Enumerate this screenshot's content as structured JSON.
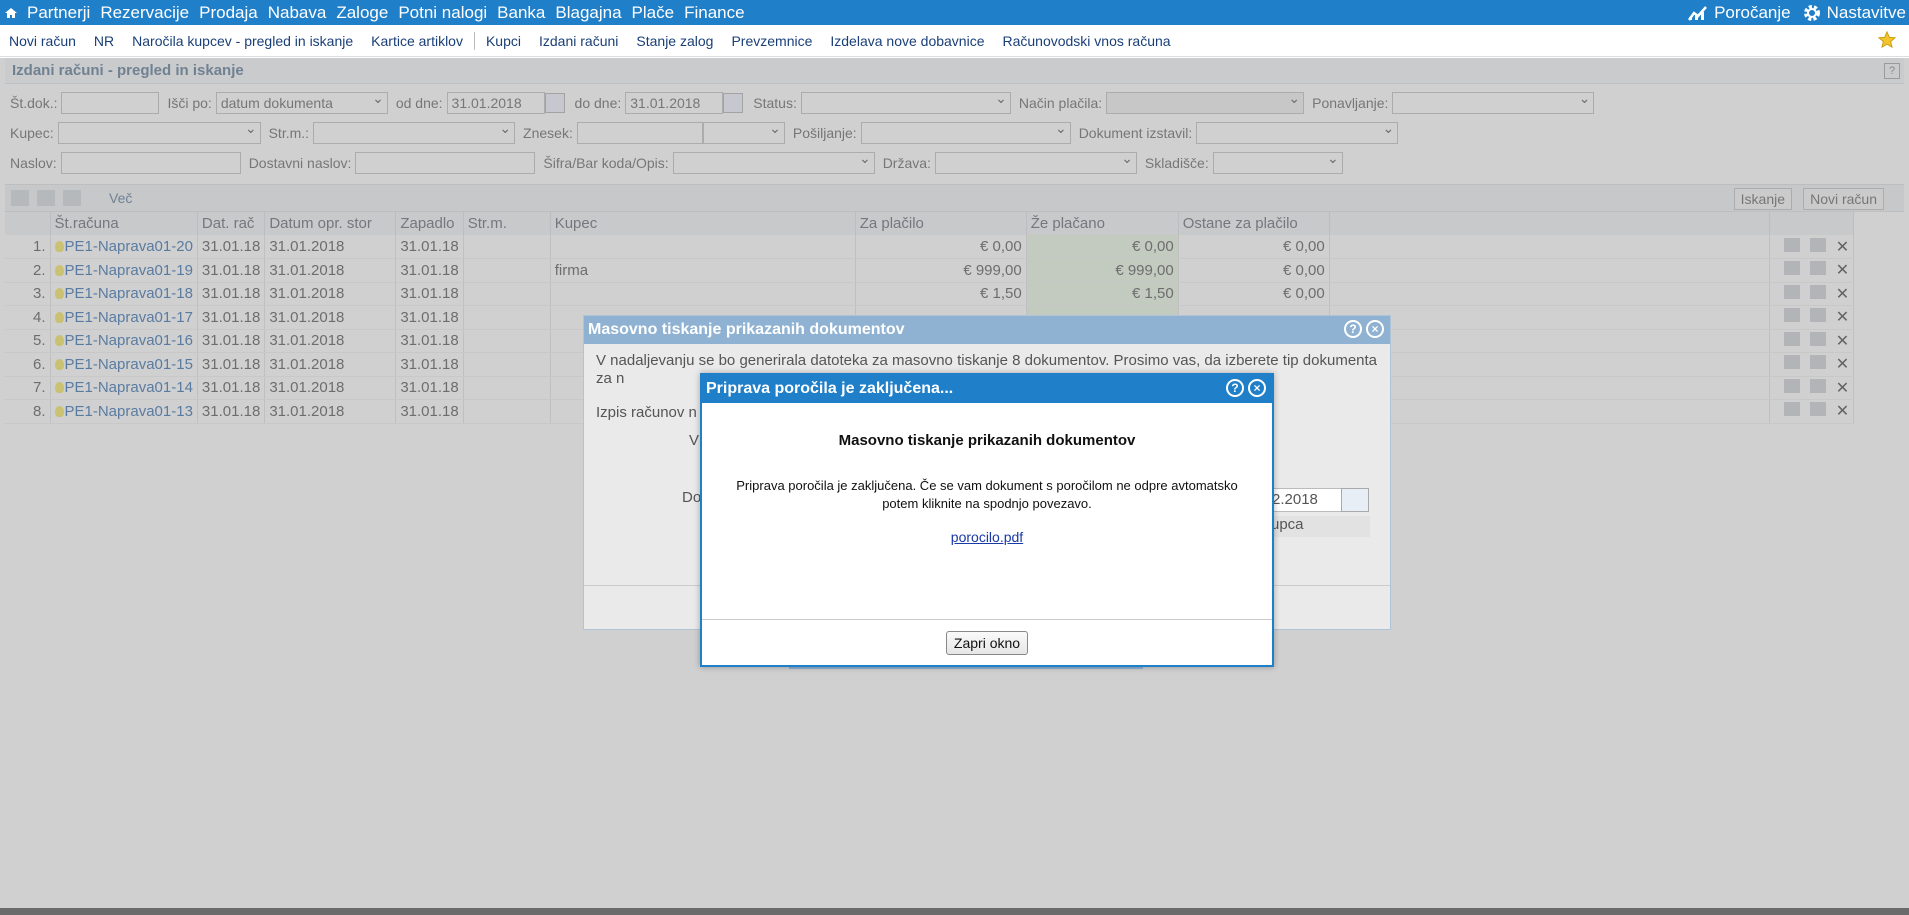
{
  "topnav": {
    "items": [
      "Partnerji",
      "Rezervacije",
      "Prodaja",
      "Nabava",
      "Zaloge",
      "Potni nalogi",
      "Banka",
      "Blagajna",
      "Plače",
      "Finance"
    ],
    "reporting": "Poročanje",
    "settings": "Nastavitve"
  },
  "subnav": {
    "items": [
      "Novi račun",
      "NR",
      "Naročila kupcev - pregled in iskanje",
      "Kartice artiklov",
      "Kupci",
      "Izdani računi",
      "Stanje zalog",
      "Prevzemnice",
      "Izdelava nove dobavnice",
      "Računovodski vnos računa"
    ]
  },
  "page": {
    "title": "Izdani računi - pregled in iskanje",
    "help": "?"
  },
  "filters": {
    "st_dok": "Št.dok.:",
    "isci_po": "Išči po:",
    "isci_po_value": "datum dokumenta",
    "od_dne": "od dne:",
    "od_dne_value": "31.01.2018",
    "do_dne": "do dne:",
    "do_dne_value": "31.01.2018",
    "status": "Status:",
    "nacin_placila": "Način plačila:",
    "ponavljanje": "Ponavljanje:",
    "kupec": "Kupec:",
    "str_m": "Str.m.:",
    "znesek": "Znesek:",
    "posiljanje": "Pošiljanje:",
    "dokument_izstavil": "Dokument izstavil:",
    "naslov": "Naslov:",
    "dostavni_naslov": "Dostavni naslov:",
    "sifra": "Šifra/Bar koda/Opis:",
    "drzava": "Država:",
    "skladisce": "Skladišče:"
  },
  "toolbar": {
    "more": "Več",
    "search": "Iskanje",
    "new_invoice": "Novi račun"
  },
  "table": {
    "columns": [
      "Št.računa",
      "Dat. rač",
      "Datum opr. stor",
      "Zapadlo",
      "Str.m.",
      "Kupec",
      "Za plačilo",
      "Že plačano",
      "Ostane za plačilo"
    ],
    "rows": [
      {
        "n": "1.",
        "id": "PE1-Naprava01-20",
        "dat": "31.01.18",
        "opr": "31.01.2018",
        "zap": "31.01.18",
        "kupec": "",
        "za": "€ 0,00",
        "ze": "€ 0,00",
        "ost": "€ 0,00"
      },
      {
        "n": "2.",
        "id": "PE1-Naprava01-19",
        "dat": "31.01.18",
        "opr": "31.01.2018",
        "zap": "31.01.18",
        "kupec": "firma",
        "za": "€ 999,00",
        "ze": "€ 999,00",
        "ost": "€ 0,00"
      },
      {
        "n": "3.",
        "id": "PE1-Naprava01-18",
        "dat": "31.01.18",
        "opr": "31.01.2018",
        "zap": "31.01.18",
        "kupec": "",
        "za": "€ 1,50",
        "ze": "€ 1,50",
        "ost": "€ 0,00"
      },
      {
        "n": "4.",
        "id": "PE1-Naprava01-17",
        "dat": "31.01.18",
        "opr": "31.01.2018",
        "zap": "31.01.18",
        "kupec": "",
        "za": "",
        "ze": "",
        "ost": ""
      },
      {
        "n": "5.",
        "id": "PE1-Naprava01-16",
        "dat": "31.01.18",
        "opr": "31.01.2018",
        "zap": "31.01.18",
        "kupec": "",
        "za": "",
        "ze": "",
        "ost": ""
      },
      {
        "n": "6.",
        "id": "PE1-Naprava01-15",
        "dat": "31.01.18",
        "opr": "31.01.2018",
        "zap": "31.01.18",
        "kupec": "",
        "za": "",
        "ze": "",
        "ost": ""
      },
      {
        "n": "7.",
        "id": "PE1-Naprava01-14",
        "dat": "31.01.18",
        "opr": "31.01.2018",
        "zap": "31.01.18",
        "kupec": "",
        "za": "",
        "ze": "",
        "ost": ""
      },
      {
        "n": "8.",
        "id": "PE1-Naprava01-13",
        "dat": "31.01.18",
        "opr": "31.01.2018",
        "zap": "31.01.18",
        "kupec": "",
        "za": "",
        "ze": "",
        "ost": ""
      }
    ]
  },
  "dialog_back": {
    "title": "Masovno tiskanje prikazanih dokumentov",
    "text": "V nadaljevanju se bo generirala datoteka za masovno tiskanje 8 dokumentov. Prosimo vas, da izberete tip dokumenta za n",
    "izpis": "Izpis računov n",
    "v": "V",
    "do": "Do",
    "date_fragment": "2.2018",
    "kupca": "upca"
  },
  "dialog_front": {
    "title": "Priprava poročila je zaključena...",
    "heading": "Masovno tiskanje prikazanih dokumentov",
    "message": "Priprava poročila je zaključena. Če se vam dokument s poročilom ne odpre avtomatsko potem kliknite na spodnjo povezavo.",
    "link": "porocilo.pdf",
    "close_button": "Zapri okno"
  },
  "colors": {
    "primary": "#1f7fc9",
    "paid_cell": "#e6f5e0",
    "link": "#1f5fa8"
  }
}
